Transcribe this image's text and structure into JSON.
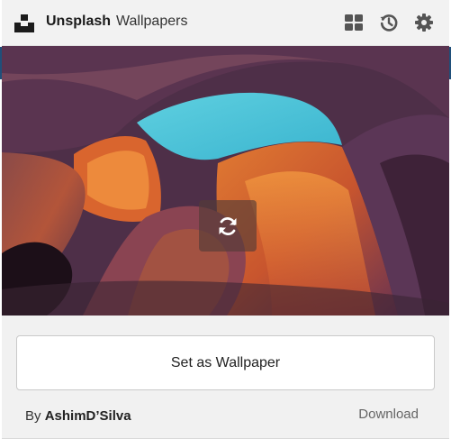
{
  "header": {
    "brand": "Unsplash",
    "subtitle": "Wallpapers",
    "icons": [
      "grid-icon",
      "history-icon",
      "settings-gear-icon"
    ]
  },
  "photo": {
    "description_icon": "refresh-icon"
  },
  "footer": {
    "set_wallpaper_label": "Set as Wallpaper",
    "by_prefix": "By",
    "author": "AshimD’Silva",
    "download_label": "Download"
  },
  "colors": {
    "header_bg": "#f2f2f2",
    "footer_bg": "#f1f1f1",
    "edge_blue": "#1f4f7a",
    "sky": "#5cc6d8"
  }
}
